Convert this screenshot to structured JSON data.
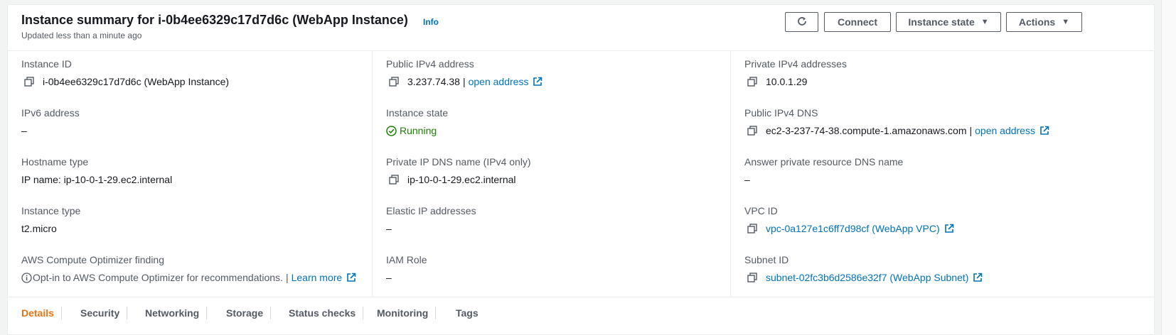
{
  "header": {
    "title": "Instance summary for i-0b4ee6329c17d7d6c (WebApp Instance)",
    "info": "Info",
    "updated": "Updated less than a minute ago",
    "buttons": {
      "connect": "Connect",
      "instance_state": "Instance state",
      "actions": "Actions"
    }
  },
  "col1": {
    "instance_id_label": "Instance ID",
    "instance_id_value": "i-0b4ee6329c17d7d6c (WebApp Instance)",
    "ipv6_label": "IPv6 address",
    "ipv6_value": "–",
    "hostname_type_label": "Hostname type",
    "hostname_type_value": "IP name: ip-10-0-1-29.ec2.internal",
    "instance_type_label": "Instance type",
    "instance_type_value": "t2.micro",
    "optimizer_label": "AWS Compute Optimizer finding",
    "optimizer_text": "Opt-in to AWS Compute Optimizer for recommendations.",
    "optimizer_sep": "|",
    "optimizer_link": "Learn more"
  },
  "col2": {
    "public_ipv4_label": "Public IPv4 address",
    "public_ipv4_value": "3.237.74.38",
    "public_ipv4_sep": "|",
    "public_ipv4_link": "open address",
    "instance_state_label": "Instance state",
    "instance_state_value": "Running",
    "private_dns_label": "Private IP DNS name (IPv4 only)",
    "private_dns_value": "ip-10-0-1-29.ec2.internal",
    "elastic_ip_label": "Elastic IP addresses",
    "elastic_ip_value": "–",
    "iam_role_label": "IAM Role",
    "iam_role_value": "–"
  },
  "col3": {
    "private_ipv4_label": "Private IPv4 addresses",
    "private_ipv4_value": "10.0.1.29",
    "public_dns_label": "Public IPv4 DNS",
    "public_dns_value": "ec2-3-237-74-38.compute-1.amazonaws.com",
    "public_dns_sep": "|",
    "public_dns_link": "open address",
    "answer_dns_label": "Answer private resource DNS name",
    "answer_dns_value": "–",
    "vpc_label": "VPC ID",
    "vpc_value": "vpc-0a127e1c6ff7d98cf (WebApp VPC)",
    "subnet_label": "Subnet ID",
    "subnet_value": "subnet-02fc3b6d2586e32f7 (WebApp Subnet)"
  },
  "tabs": [
    "Details",
    "Security",
    "Networking",
    "Storage",
    "Status checks",
    "Monitoring",
    "Tags"
  ],
  "colors": {
    "link": "#0073bb",
    "running": "#1d8102",
    "active_tab": "#ec7211",
    "label": "#545b64"
  }
}
